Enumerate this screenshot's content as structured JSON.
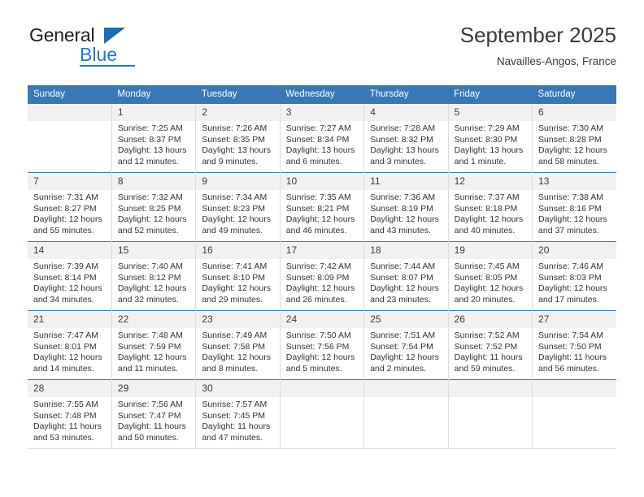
{
  "brand": {
    "name_part1": "General",
    "name_part2": "Blue"
  },
  "header": {
    "title": "September 2025",
    "subtitle": "Navailles-Angos, France"
  },
  "colors": {
    "header_blue": "#3878b4",
    "brand_blue": "#1b7ad1",
    "daynum_bg": "#f1f1f1",
    "text": "#333333"
  },
  "weekdays": [
    "Sunday",
    "Monday",
    "Tuesday",
    "Wednesday",
    "Thursday",
    "Friday",
    "Saturday"
  ],
  "weeks": [
    [
      {
        "empty": true,
        "day": ""
      },
      {
        "day": "1",
        "sunrise": "Sunrise: 7:25 AM",
        "sunset": "Sunset: 8:37 PM",
        "daylight": "Daylight: 13 hours and 12 minutes."
      },
      {
        "day": "2",
        "sunrise": "Sunrise: 7:26 AM",
        "sunset": "Sunset: 8:35 PM",
        "daylight": "Daylight: 13 hours and 9 minutes."
      },
      {
        "day": "3",
        "sunrise": "Sunrise: 7:27 AM",
        "sunset": "Sunset: 8:34 PM",
        "daylight": "Daylight: 13 hours and 6 minutes."
      },
      {
        "day": "4",
        "sunrise": "Sunrise: 7:28 AM",
        "sunset": "Sunset: 8:32 PM",
        "daylight": "Daylight: 13 hours and 3 minutes."
      },
      {
        "day": "5",
        "sunrise": "Sunrise: 7:29 AM",
        "sunset": "Sunset: 8:30 PM",
        "daylight": "Daylight: 13 hours and 1 minute."
      },
      {
        "day": "6",
        "sunrise": "Sunrise: 7:30 AM",
        "sunset": "Sunset: 8:28 PM",
        "daylight": "Daylight: 12 hours and 58 minutes."
      }
    ],
    [
      {
        "day": "7",
        "sunrise": "Sunrise: 7:31 AM",
        "sunset": "Sunset: 8:27 PM",
        "daylight": "Daylight: 12 hours and 55 minutes."
      },
      {
        "day": "8",
        "sunrise": "Sunrise: 7:32 AM",
        "sunset": "Sunset: 8:25 PM",
        "daylight": "Daylight: 12 hours and 52 minutes."
      },
      {
        "day": "9",
        "sunrise": "Sunrise: 7:34 AM",
        "sunset": "Sunset: 8:23 PM",
        "daylight": "Daylight: 12 hours and 49 minutes."
      },
      {
        "day": "10",
        "sunrise": "Sunrise: 7:35 AM",
        "sunset": "Sunset: 8:21 PM",
        "daylight": "Daylight: 12 hours and 46 minutes."
      },
      {
        "day": "11",
        "sunrise": "Sunrise: 7:36 AM",
        "sunset": "Sunset: 8:19 PM",
        "daylight": "Daylight: 12 hours and 43 minutes."
      },
      {
        "day": "12",
        "sunrise": "Sunrise: 7:37 AM",
        "sunset": "Sunset: 8:18 PM",
        "daylight": "Daylight: 12 hours and 40 minutes."
      },
      {
        "day": "13",
        "sunrise": "Sunrise: 7:38 AM",
        "sunset": "Sunset: 8:16 PM",
        "daylight": "Daylight: 12 hours and 37 minutes."
      }
    ],
    [
      {
        "day": "14",
        "sunrise": "Sunrise: 7:39 AM",
        "sunset": "Sunset: 8:14 PM",
        "daylight": "Daylight: 12 hours and 34 minutes."
      },
      {
        "day": "15",
        "sunrise": "Sunrise: 7:40 AM",
        "sunset": "Sunset: 8:12 PM",
        "daylight": "Daylight: 12 hours and 32 minutes."
      },
      {
        "day": "16",
        "sunrise": "Sunrise: 7:41 AM",
        "sunset": "Sunset: 8:10 PM",
        "daylight": "Daylight: 12 hours and 29 minutes."
      },
      {
        "day": "17",
        "sunrise": "Sunrise: 7:42 AM",
        "sunset": "Sunset: 8:09 PM",
        "daylight": "Daylight: 12 hours and 26 minutes."
      },
      {
        "day": "18",
        "sunrise": "Sunrise: 7:44 AM",
        "sunset": "Sunset: 8:07 PM",
        "daylight": "Daylight: 12 hours and 23 minutes."
      },
      {
        "day": "19",
        "sunrise": "Sunrise: 7:45 AM",
        "sunset": "Sunset: 8:05 PM",
        "daylight": "Daylight: 12 hours and 20 minutes."
      },
      {
        "day": "20",
        "sunrise": "Sunrise: 7:46 AM",
        "sunset": "Sunset: 8:03 PM",
        "daylight": "Daylight: 12 hours and 17 minutes."
      }
    ],
    [
      {
        "day": "21",
        "sunrise": "Sunrise: 7:47 AM",
        "sunset": "Sunset: 8:01 PM",
        "daylight": "Daylight: 12 hours and 14 minutes."
      },
      {
        "day": "22",
        "sunrise": "Sunrise: 7:48 AM",
        "sunset": "Sunset: 7:59 PM",
        "daylight": "Daylight: 12 hours and 11 minutes."
      },
      {
        "day": "23",
        "sunrise": "Sunrise: 7:49 AM",
        "sunset": "Sunset: 7:58 PM",
        "daylight": "Daylight: 12 hours and 8 minutes."
      },
      {
        "day": "24",
        "sunrise": "Sunrise: 7:50 AM",
        "sunset": "Sunset: 7:56 PM",
        "daylight": "Daylight: 12 hours and 5 minutes."
      },
      {
        "day": "25",
        "sunrise": "Sunrise: 7:51 AM",
        "sunset": "Sunset: 7:54 PM",
        "daylight": "Daylight: 12 hours and 2 minutes."
      },
      {
        "day": "26",
        "sunrise": "Sunrise: 7:52 AM",
        "sunset": "Sunset: 7:52 PM",
        "daylight": "Daylight: 11 hours and 59 minutes."
      },
      {
        "day": "27",
        "sunrise": "Sunrise: 7:54 AM",
        "sunset": "Sunset: 7:50 PM",
        "daylight": "Daylight: 11 hours and 56 minutes."
      }
    ],
    [
      {
        "day": "28",
        "sunrise": "Sunrise: 7:55 AM",
        "sunset": "Sunset: 7:48 PM",
        "daylight": "Daylight: 11 hours and 53 minutes."
      },
      {
        "day": "29",
        "sunrise": "Sunrise: 7:56 AM",
        "sunset": "Sunset: 7:47 PM",
        "daylight": "Daylight: 11 hours and 50 minutes."
      },
      {
        "day": "30",
        "sunrise": "Sunrise: 7:57 AM",
        "sunset": "Sunset: 7:45 PM",
        "daylight": "Daylight: 11 hours and 47 minutes."
      },
      {
        "empty": true,
        "day": ""
      },
      {
        "empty": true,
        "day": ""
      },
      {
        "empty": true,
        "day": ""
      },
      {
        "empty": true,
        "day": ""
      }
    ]
  ]
}
